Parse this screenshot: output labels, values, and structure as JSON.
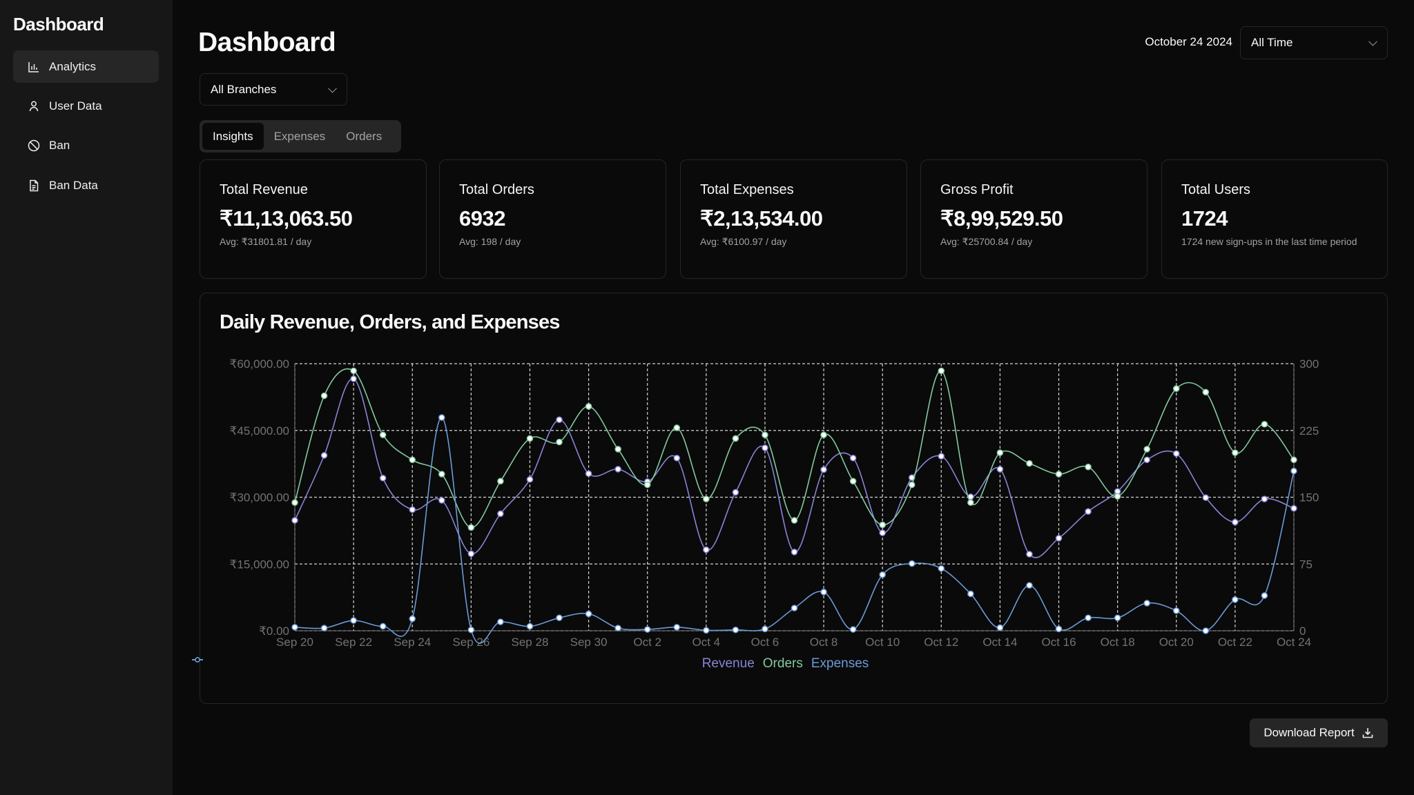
{
  "sidebar": {
    "title": "Dashboard",
    "items": [
      {
        "label": "Analytics",
        "icon": "bar-chart-icon",
        "active": true
      },
      {
        "label": "User Data",
        "icon": "user-icon"
      },
      {
        "label": "Ban",
        "icon": "ban-icon"
      },
      {
        "label": "Ban Data",
        "icon": "file-text-icon"
      }
    ]
  },
  "header": {
    "title": "Dashboard",
    "date": "October 24 2024",
    "range_select": "All Time",
    "branch_select": "All Branches"
  },
  "tabs": [
    {
      "label": "Insights",
      "active": true
    },
    {
      "label": "Expenses"
    },
    {
      "label": "Orders"
    }
  ],
  "cards": [
    {
      "title": "Total Revenue",
      "value": "₹11,13,063.50",
      "sub": "Avg: ₹31801.81 / day"
    },
    {
      "title": "Total Orders",
      "value": "6932",
      "sub": "Avg: 198 / day"
    },
    {
      "title": "Total Expenses",
      "value": "₹2,13,534.00",
      "sub": "Avg: ₹6100.97 / day"
    },
    {
      "title": "Gross Profit",
      "value": "₹8,99,529.50",
      "sub": "Avg: ₹25700.84 / day"
    },
    {
      "title": "Total Users",
      "value": "1724",
      "sub": "1724 new sign-ups in the last time period"
    }
  ],
  "download_label": "Download Report",
  "chart_data": {
    "type": "line",
    "title": "Daily Revenue, Orders, and Expenses",
    "x": [
      "Sep 20",
      "Sep 21",
      "Sep 22",
      "Sep 23",
      "Sep 24",
      "Sep 25",
      "Sep 26",
      "Sep 27",
      "Sep 28",
      "Sep 29",
      "Sep 30",
      "Oct 1",
      "Oct 2",
      "Oct 3",
      "Oct 4",
      "Oct 5",
      "Oct 6",
      "Oct 7",
      "Oct 8",
      "Oct 9",
      "Oct 10",
      "Oct 11",
      "Oct 12",
      "Oct 13",
      "Oct 14",
      "Oct 15",
      "Oct 16",
      "Oct 17",
      "Oct 18",
      "Oct 19",
      "Oct 20",
      "Oct 21",
      "Oct 22",
      "Oct 23",
      "Oct 24"
    ],
    "x_tick_labels": [
      "Sep 20",
      "Sep 22",
      "Sep 24",
      "Sep 26",
      "Sep 28",
      "Sep 30",
      "Oct 2",
      "Oct 4",
      "Oct 6",
      "Oct 8",
      "Oct 10",
      "Oct 12",
      "Oct 14",
      "Oct 16",
      "Oct 18",
      "Oct 20",
      "Oct 22",
      "Oct 24"
    ],
    "y_left": {
      "ticks": [
        "₹0.00",
        "₹15,000.00",
        "₹30,000.00",
        "₹45,000.00",
        "₹60,000.00"
      ],
      "range": [
        0,
        60000
      ]
    },
    "y_right": {
      "ticks": [
        "0",
        "75",
        "150",
        "225",
        "300"
      ],
      "range": [
        0,
        300
      ]
    },
    "grid": true,
    "legend": "bottom",
    "series": [
      {
        "name": "Revenue",
        "axis": "left",
        "color": "#8884d8",
        "values": [
          24800,
          39400,
          56600,
          34300,
          27200,
          29300,
          17300,
          26300,
          34000,
          47400,
          35300,
          36300,
          33500,
          38800,
          18200,
          31100,
          41100,
          17700,
          36200,
          38800,
          22000,
          34400,
          39200,
          30100,
          36300,
          17200,
          20800,
          26800,
          31300,
          38400,
          39800,
          29900,
          24400,
          29600,
          27500
        ]
      },
      {
        "name": "Orders",
        "axis": "right",
        "color": "#82ca9d",
        "values": [
          144,
          264,
          292,
          220,
          192,
          176,
          116,
          168,
          216,
          212,
          252,
          204,
          164,
          228,
          148,
          216,
          220,
          124,
          220,
          168,
          119,
          164,
          292,
          144,
          200,
          188,
          176,
          184,
          151,
          204,
          272,
          268,
          200,
          232,
          192
        ]
      },
      {
        "name": "Expenses",
        "axis": "left",
        "color": "#6a9bd8",
        "values": [
          800,
          600,
          2300,
          1000,
          2700,
          47900,
          200,
          2000,
          1000,
          2900,
          3800,
          600,
          300,
          800,
          100,
          200,
          400,
          5100,
          8700,
          300,
          12600,
          15100,
          14000,
          8300,
          700,
          10200,
          400,
          2900,
          2900,
          6200,
          4500,
          0,
          7000,
          7900,
          35900
        ]
      }
    ]
  }
}
